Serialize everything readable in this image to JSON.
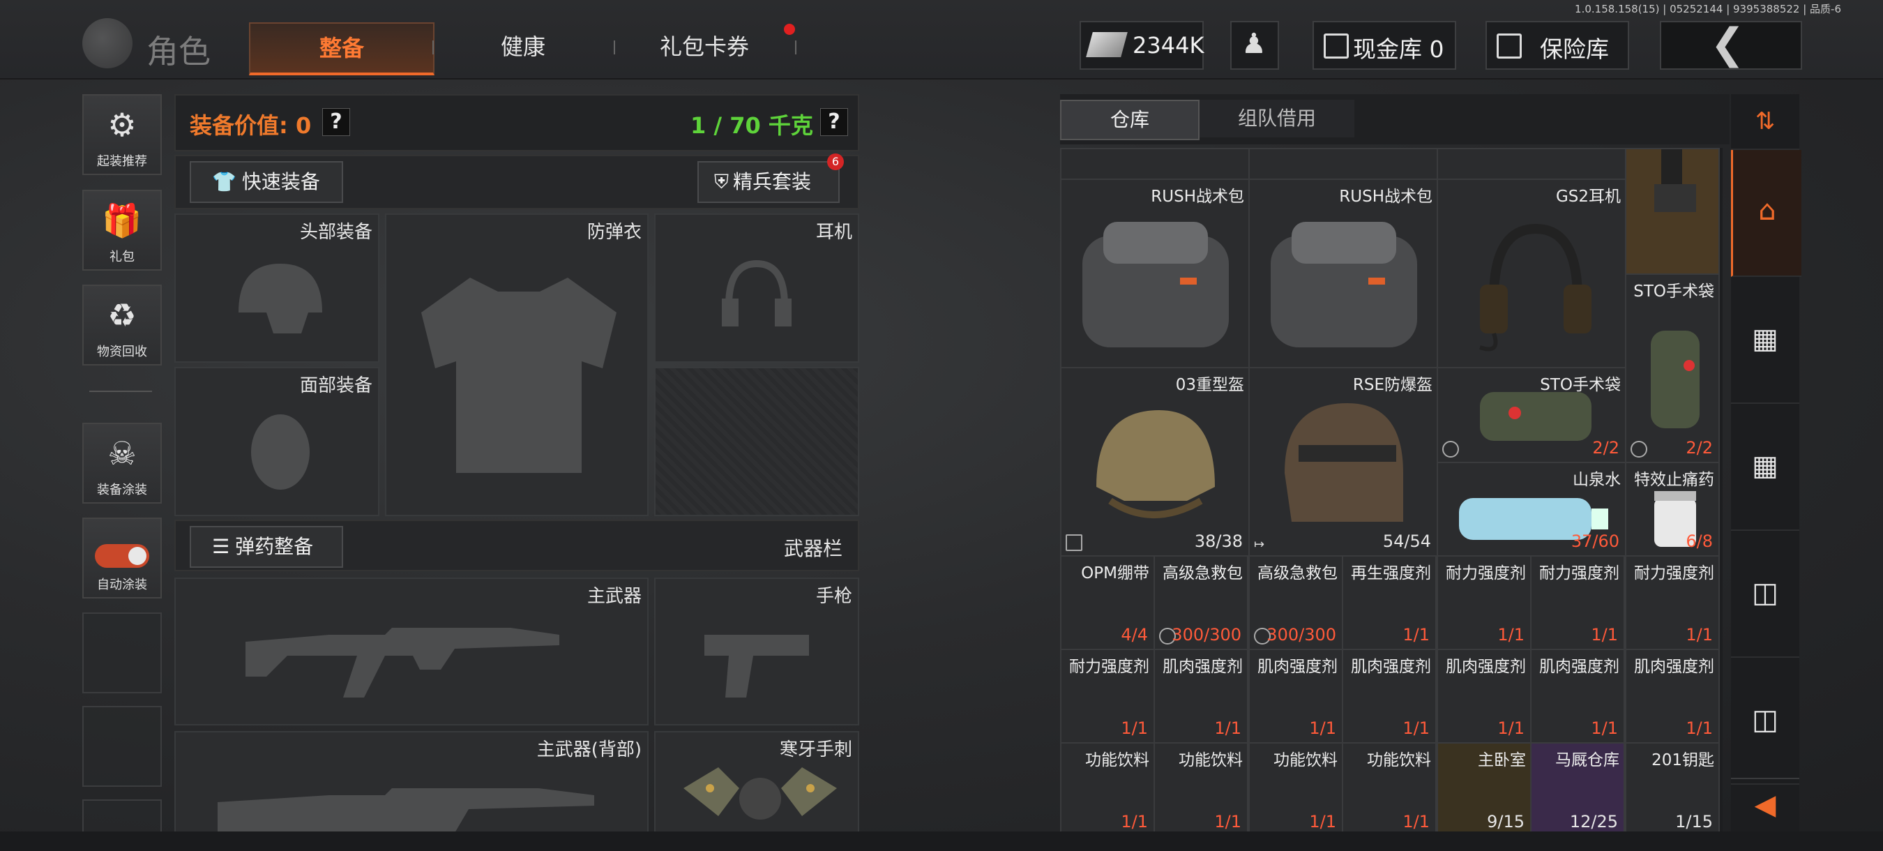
{
  "version": "1.0.158.158(15) | 05252144 | 9395388522 | 品质-6",
  "header": {
    "title": "角色",
    "tabs": [
      {
        "label": "整备"
      },
      {
        "label": "健康"
      },
      {
        "label": "礼包卡券"
      }
    ],
    "money": "2344K",
    "cash_vault": "现金库 0",
    "safe": "保险库"
  },
  "sidebar": {
    "items": [
      {
        "label": "起装推荐",
        "icon": "helmet-gear-icon"
      },
      {
        "label": "礼包",
        "icon": "gift-icon"
      },
      {
        "label": "物资回收",
        "icon": "recycle-icon"
      },
      {
        "label": "装备涂装",
        "icon": "paint-soldier-icon"
      },
      {
        "label": "自动涂装",
        "icon": "toggle-icon"
      }
    ]
  },
  "loadout": {
    "value_label": "装备价值: 0",
    "weight_label": "1 / 70 千克",
    "help": "?",
    "quick_equip": "快速装备",
    "elite_set": "精兵套装",
    "elite_badge": "6",
    "slots": {
      "head": "头部装备",
      "armor": "防弹衣",
      "headset": "耳机",
      "face": "面部装备",
      "primary": "主武器",
      "pistol": "手枪",
      "primary_back": "主武器(背部)",
      "melee": "寒牙手刺"
    },
    "ammo_prep": "弹药整备",
    "weapon_bar": "武器栏"
  },
  "warehouse": {
    "tabs": [
      {
        "label": "仓库"
      },
      {
        "label": "组队借用"
      }
    ],
    "items": [
      {
        "name": "RUSH战术包",
        "count": ""
      },
      {
        "name": "RUSH战术包",
        "count": ""
      },
      {
        "name": "GS2耳机",
        "count": ""
      },
      {
        "name": "STO手术袋",
        "count": "2/2"
      },
      {
        "name": "03重型盔",
        "count": "38/38"
      },
      {
        "name": "RSE防爆盔",
        "count": "54/54"
      },
      {
        "name": "STO手术袋",
        "count": "2/2"
      },
      {
        "name": "山泉水",
        "count": "37/60"
      },
      {
        "name": "特效止痛药",
        "count": "6/8"
      },
      {
        "name": "OPM绷带",
        "count": "4/4"
      },
      {
        "name": "高级急救包",
        "count": "300/300"
      },
      {
        "name": "高级急救包",
        "count": "300/300"
      },
      {
        "name": "再生强度剂",
        "count": "1/1"
      },
      {
        "name": "耐力强度剂",
        "count": "1/1"
      },
      {
        "name": "耐力强度剂",
        "count": "1/1"
      },
      {
        "name": "耐力强度剂",
        "count": "1/1"
      },
      {
        "name": "耐力强度剂",
        "count": "1/1"
      },
      {
        "name": "肌肉强度剂",
        "count": "1/1"
      },
      {
        "name": "肌肉强度剂",
        "count": "1/1"
      },
      {
        "name": "肌肉强度剂",
        "count": "1/1"
      },
      {
        "name": "肌肉强度剂",
        "count": "1/1"
      },
      {
        "name": "肌肉强度剂",
        "count": "1/1"
      },
      {
        "name": "肌肉强度剂",
        "count": "1/1"
      },
      {
        "name": "功能饮料",
        "count": "1/1"
      },
      {
        "name": "功能饮料",
        "count": "1/1"
      },
      {
        "name": "功能饮料",
        "count": "1/1"
      },
      {
        "name": "功能饮料",
        "count": "1/1"
      },
      {
        "name": "主卧室",
        "count": "9/15"
      },
      {
        "name": "马厩仓库",
        "count": "12/25"
      },
      {
        "name": "201钥匙",
        "count": "1/15"
      }
    ]
  },
  "colors": {
    "accent": "#f06a2a",
    "count_red": "#ff5a3a",
    "weight_green": "#5ed33a"
  }
}
